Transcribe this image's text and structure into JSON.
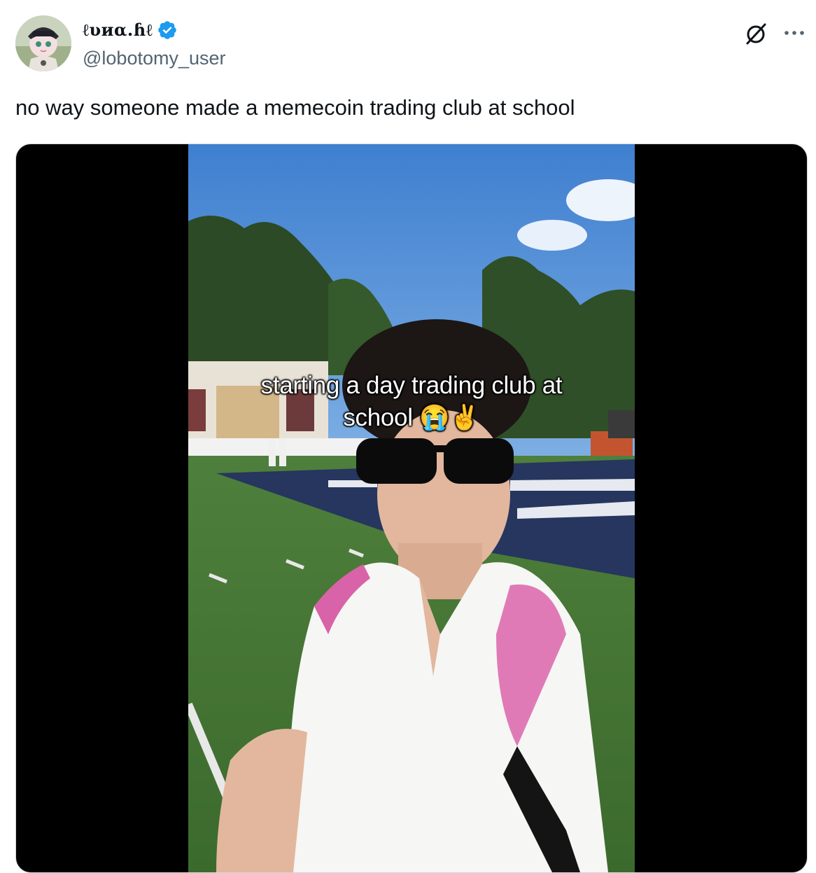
{
  "author": {
    "display_name": "ℓυиα.ɦℓ",
    "handle": "@lobotomy_user",
    "verified": true,
    "avatar_icon": "avatar-anime-girl"
  },
  "actions": {
    "grok_icon": "grok-slash-icon",
    "more_icon": "more-dots-icon"
  },
  "tweet": {
    "text": "no way someone made a memecoin trading club at school"
  },
  "media": {
    "type": "video",
    "caption_line1": "starting a day trading club at",
    "caption_line2": "school 😭✌️"
  },
  "colors": {
    "verified_blue": "#1d9bf0",
    "text_primary": "#0f1419",
    "text_secondary": "#536471",
    "border": "#cfd9de"
  }
}
